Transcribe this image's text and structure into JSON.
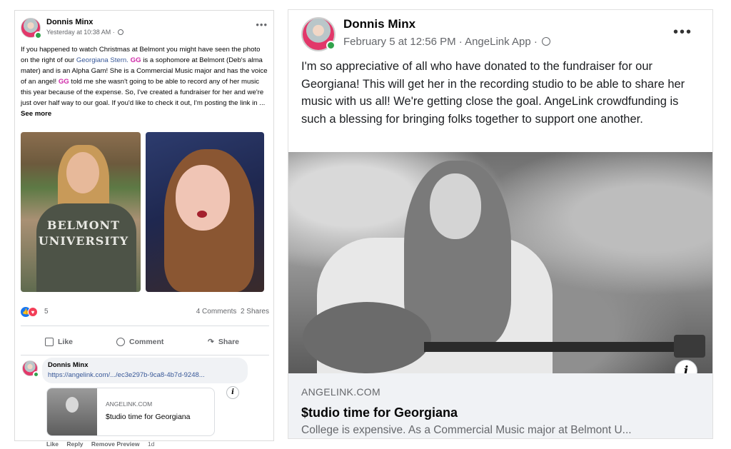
{
  "left_post": {
    "author": "Donnis Minx",
    "timestamp": "Yesterday at 10:38 AM",
    "body_parts": {
      "p1": "If you happened to watch Christmas at Belmont you might have seen the photo on the right of our ",
      "mention": "Georgiana Stern.",
      "gg1": "GG",
      "p2": " is a sophomore at Belmont (Deb's alma mater) and is an Alpha Gam! She is a Commercial Music major and has the voice of an angel! ",
      "gg2": "GG",
      "p3": " told me she wasn't going to be able to record any of her music this year because of the expense. So, I've created a fundraiser for her and we're just over half way to our goal. If you'd like to check it out, I'm posting the link in ... ",
      "see_more": "See more"
    },
    "photo_sweater_text": "BELMONT UNIVERSITY",
    "reaction_count": "5",
    "comments_count": "4 Comments",
    "shares_count": "2 Shares",
    "actions": {
      "like": "Like",
      "comment": "Comment",
      "share": "Share"
    },
    "comment": {
      "author": "Donnis Minx",
      "url": "https://angelink.com/.../ec3e297b-9ca8-4b7d-9248...",
      "preview_domain": "ANGELINK.COM",
      "preview_title": "$tudio time for Georgiana",
      "links": {
        "like": "Like",
        "reply": "Reply",
        "remove": "Remove Preview",
        "time": "1d"
      }
    }
  },
  "right_post": {
    "author": "Donnis Minx",
    "meta": "February 5 at 12:56 PM · AngeLink App ·",
    "body": "I'm so appreciative of all who have donated to the fundraiser for our Georgiana! This will get her in the recording studio to be able to share her music with us all! We're getting close the goal. AngeLink crowdfunding is such a blessing for bringing folks together to support one another.",
    "link_domain": "ANGELINK.COM",
    "link_title": "$tudio time for Georgiana",
    "link_desc": "College is expensive. As a Commercial Music major at Belmont U..."
  },
  "icons": {
    "info": "i",
    "more": "•••"
  },
  "colors": {
    "facebook_blue": "#1877f2",
    "link": "#385898",
    "gg_pink": "#cf2aa8",
    "muted": "#65676b"
  }
}
